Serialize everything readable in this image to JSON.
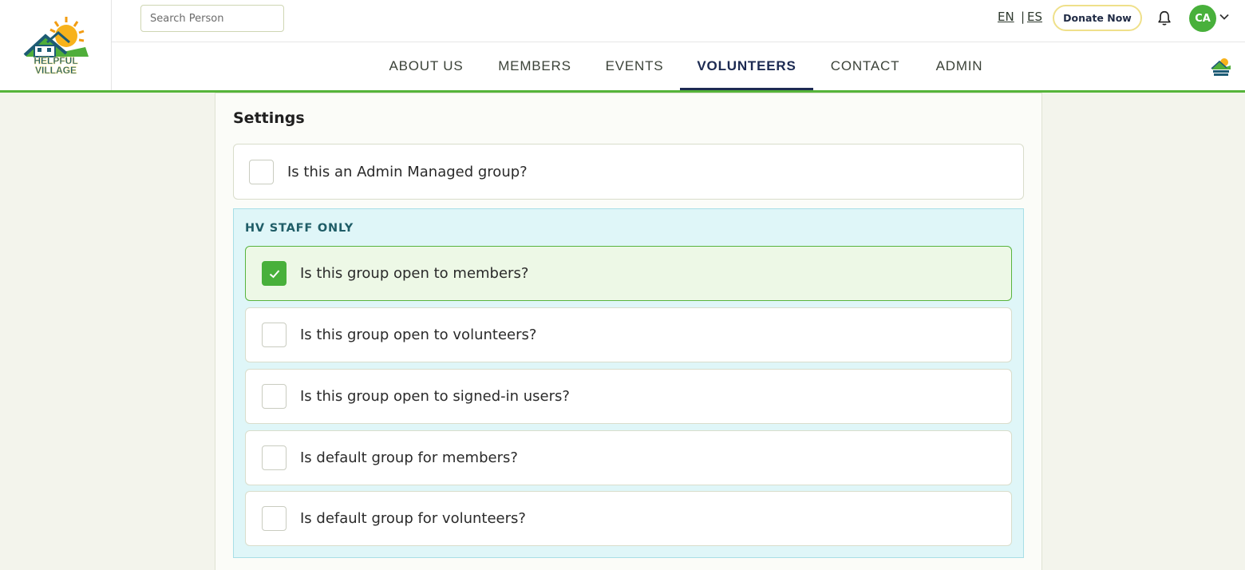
{
  "header": {
    "logo_text": "HELPFUL VILLAGE",
    "search_placeholder": "Search Person",
    "lang_en": "EN",
    "lang_sep": "|",
    "lang_es": "ES",
    "donate_label": "Donate Now",
    "avatar_initials": "CA",
    "accent_color": "#55b43a"
  },
  "nav": {
    "items": [
      {
        "label": "ABOUT US"
      },
      {
        "label": "MEMBERS"
      },
      {
        "label": "EVENTS"
      },
      {
        "label": "VOLUNTEERS",
        "active": true
      },
      {
        "label": "CONTACT"
      },
      {
        "label": "ADMIN"
      }
    ]
  },
  "settings": {
    "title": "Settings",
    "admin_managed": {
      "label": "Is this an Admin Managed group?",
      "checked": false
    },
    "staff_section": {
      "title": "HV STAFF ONLY",
      "options": [
        {
          "label": "Is this group open to members?",
          "checked": true
        },
        {
          "label": "Is this group open to volunteers?",
          "checked": false
        },
        {
          "label": "Is this group open to signed-in users?",
          "checked": false
        },
        {
          "label": "Is default group for members?",
          "checked": false
        },
        {
          "label": "Is default group for volunteers?",
          "checked": false
        }
      ]
    }
  }
}
